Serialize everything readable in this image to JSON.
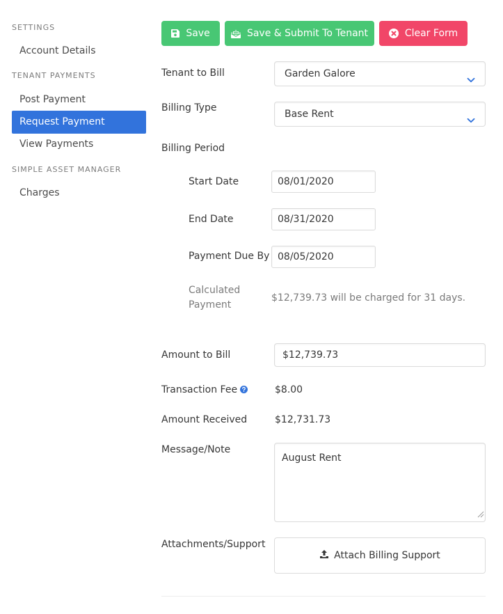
{
  "sidebar": {
    "sections": [
      {
        "label": "SETTINGS"
      },
      {
        "label": "TENANT PAYMENTS"
      },
      {
        "label": "SIMPLE ASSET MANAGER"
      }
    ],
    "items": [
      {
        "label": "Account Details",
        "active": false
      },
      {
        "label": "Post Payment",
        "active": false
      },
      {
        "label": "Request Payment",
        "active": true
      },
      {
        "label": "View Payments",
        "active": false
      },
      {
        "label": "Charges",
        "active": false
      }
    ]
  },
  "toolbar": {
    "save_label": "Save",
    "save_submit_label": "Save & Submit To Tenant",
    "clear_label": "Clear Form"
  },
  "form": {
    "tenant_label": "Tenant to Bill",
    "tenant_value": "Garden Galore",
    "billing_type_label": "Billing Type",
    "billing_type_value": "Base Rent",
    "billing_period_label": "Billing Period",
    "start_date_label": "Start Date",
    "start_date_value": "08/01/2020",
    "end_date_label": "End Date",
    "end_date_value": "08/31/2020",
    "due_label": "Payment Due By",
    "due_value": "08/05/2020",
    "calculated_label": "Calculated Payment",
    "calculated_text": "$12,739.73 will be charged for 31 days.",
    "amount_label": "Amount to Bill",
    "amount_value": "$12,739.73",
    "fee_label": "Transaction Fee",
    "fee_value": "$8.00",
    "received_label": "Amount Received",
    "received_value": "$12,731.73",
    "message_label": "Message/Note",
    "message_value": "August Rent",
    "attachments_label": "Attachments/Support",
    "attach_button_label": "Attach Billing Support"
  },
  "colors": {
    "primary": "#3273dc",
    "success": "#48c774",
    "danger": "#f14668",
    "info": "#3273dc"
  },
  "icons": {
    "save": "floppy-disk-icon",
    "submit": "envelope-open-icon",
    "clear": "times-circle-icon",
    "select": "chevron-down-icon",
    "help": "question-circle-icon",
    "attach": "upload-icon"
  }
}
